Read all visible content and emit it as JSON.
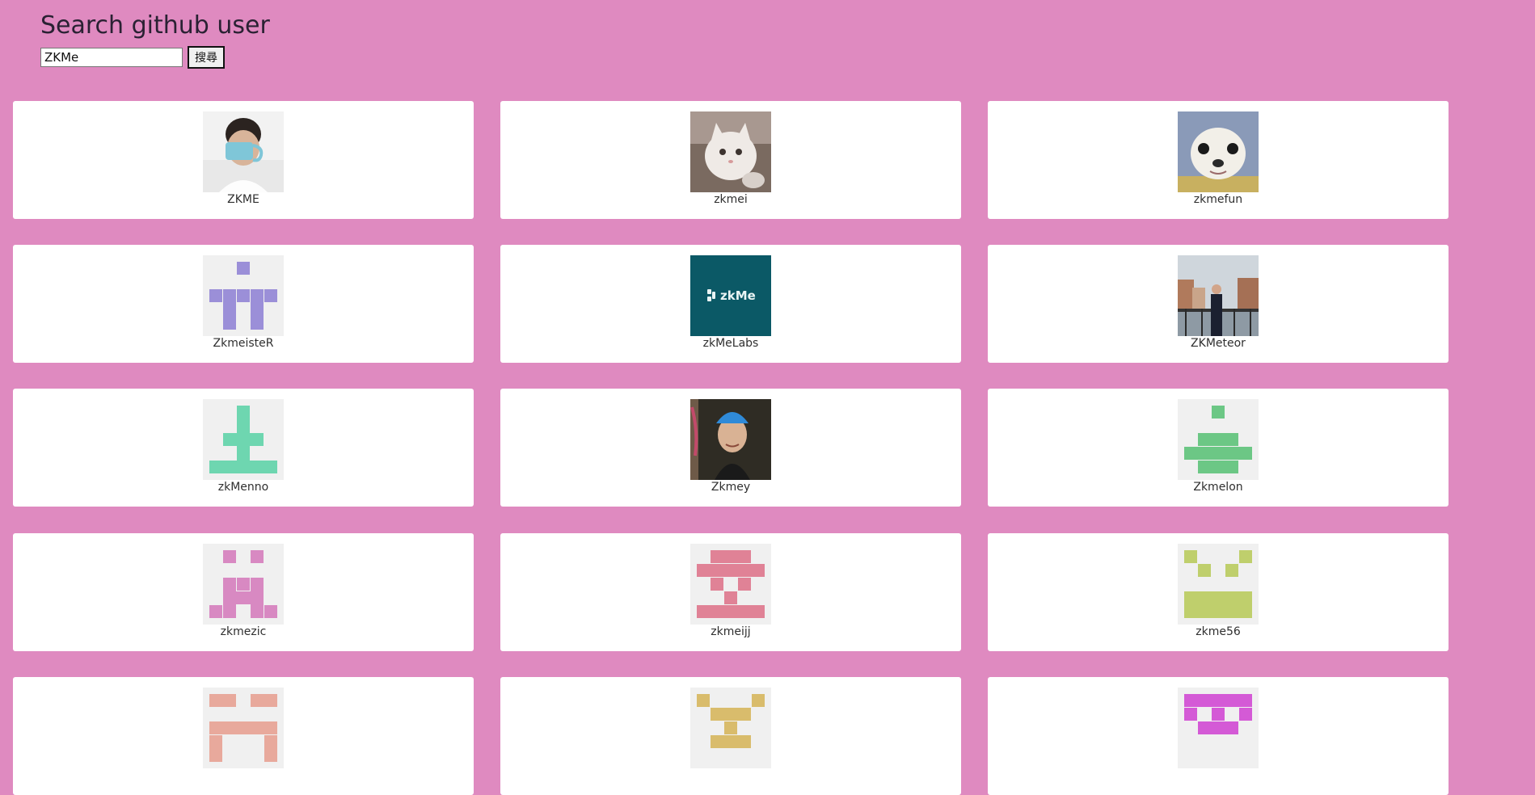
{
  "header": {
    "title": "Search github user",
    "search_value": "ZKMe",
    "search_button": "搜尋"
  },
  "results": [
    {
      "login": "ZKME",
      "avatar": "photo-person-mug"
    },
    {
      "login": "zkmei",
      "avatar": "photo-cat"
    },
    {
      "login": "zkmefun",
      "avatar": "photo-chihuahua"
    },
    {
      "login": "ZkmeisteR",
      "avatar": "identicon",
      "color": "#9b8fd8"
    },
    {
      "login": "zkMeLabs",
      "avatar": "logo",
      "logo_text": "zkMe"
    },
    {
      "login": "ZKMeteor",
      "avatar": "photo-city-person"
    },
    {
      "login": "zkMenno",
      "avatar": "identicon",
      "color": "#6ed6b0"
    },
    {
      "login": "Zkmey",
      "avatar": "photo-person-helmet"
    },
    {
      "login": "Zkmelon",
      "avatar": "identicon",
      "color": "#6cc785"
    },
    {
      "login": "zkmezic",
      "avatar": "identicon",
      "color": "#d889c2"
    },
    {
      "login": "zkmeijj",
      "avatar": "identicon",
      "color": "#e08296"
    },
    {
      "login": "zkme56",
      "avatar": "identicon",
      "color": "#bfcf6c"
    },
    {
      "login": "",
      "avatar": "identicon",
      "color": "#e8a99c"
    },
    {
      "login": "",
      "avatar": "identicon",
      "color": "#d9bc6c"
    },
    {
      "login": "",
      "avatar": "identicon",
      "color": "#d45ad6"
    }
  ]
}
